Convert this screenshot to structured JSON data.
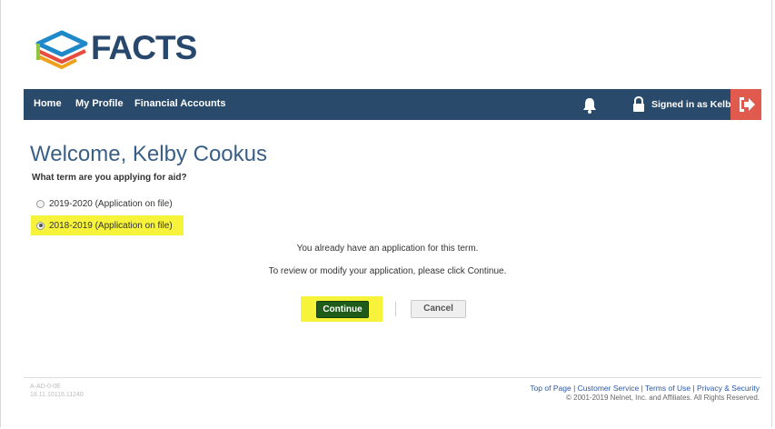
{
  "brand": {
    "name": "FACTS"
  },
  "nav": {
    "items": [
      "Home",
      "My Profile",
      "Financial Accounts"
    ],
    "signed_in": "Signed in as Kelby"
  },
  "welcome": "Welcome, Kelby Cookus",
  "question": "What term are you applying for aid?",
  "options": [
    {
      "label": "2019-2020 (Application on file)",
      "selected": false
    },
    {
      "label": "2018-2019 (Application on file)",
      "selected": true
    }
  ],
  "messages": {
    "line1": "You already have an application for this term.",
    "line2": "To review or modify your application, please click Continue."
  },
  "buttons": {
    "continue": "Continue",
    "cancel": "Cancel"
  },
  "footer": {
    "code1": "A-AD-0-0E",
    "code2": "18.11.10116.11240",
    "links": [
      "Top of Page",
      "Customer Service",
      "Terms of Use",
      "Privacy & Security"
    ],
    "copyright": "© 2001-2019 Nelnet, Inc. and Affiliates. All Rights Reserved."
  },
  "colors": {
    "navbar": "#2a4a6b",
    "logout": "#e05a4e",
    "highlight": "#f6f33a",
    "continue_btn": "#1f5c1a",
    "welcome_text": "#3a5f86"
  },
  "icons": [
    "facts-logo-icon",
    "bell-icon",
    "lock-icon",
    "logout-icon"
  ]
}
